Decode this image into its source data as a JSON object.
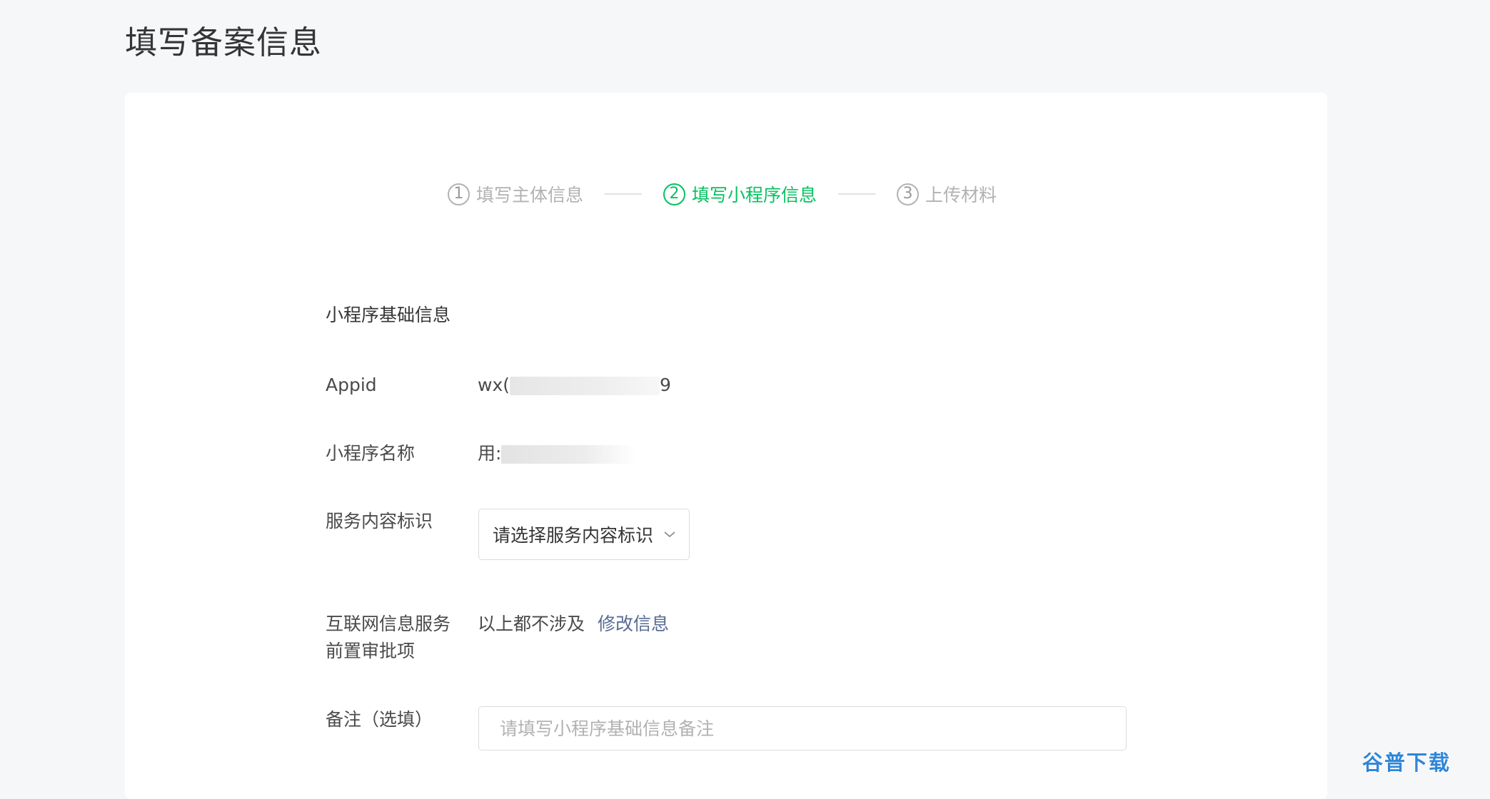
{
  "page": {
    "title": "填写备案信息"
  },
  "steps": [
    {
      "number": "1",
      "label": "填写主体信息",
      "state": "done"
    },
    {
      "number": "2",
      "label": "填写小程序信息",
      "state": "active"
    },
    {
      "number": "3",
      "label": "上传材料",
      "state": "pending"
    }
  ],
  "form": {
    "section_title": "小程序基础信息",
    "appid": {
      "label": "Appid",
      "value_prefix": "wx(",
      "value_suffix": "9"
    },
    "name": {
      "label": "小程序名称",
      "value_prefix": "用:"
    },
    "service_type": {
      "label": "服务内容标识",
      "placeholder": "请选择服务内容标识"
    },
    "approval": {
      "label_line1": "互联网信息服务",
      "label_line2": "前置审批项",
      "value": "以上都不涉及",
      "link": "修改信息"
    },
    "remark": {
      "label": "备注（选填）",
      "placeholder": "请填写小程序基础信息备注"
    }
  },
  "watermark": "谷普下载",
  "colors": {
    "accent": "#07c160",
    "link": "#576b95",
    "background": "#f6f7f9",
    "card": "#ffffff"
  }
}
